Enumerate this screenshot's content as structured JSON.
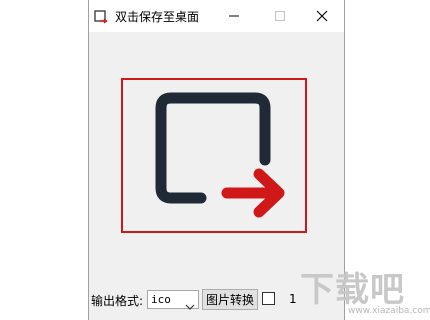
{
  "window": {
    "title": "双击保存至桌面"
  },
  "toolbar": {
    "format_label": "输出格式:",
    "format_value": "ico",
    "convert_label": "图片转换",
    "trailing_text": "1"
  },
  "watermark": {
    "brand": "下载吧",
    "url": "www.xiazaiba.com"
  },
  "colors": {
    "frame_border": "#d01818",
    "arrow": "#d01818",
    "square_stroke": "#1f2a36",
    "window_bg": "#f0f0f0"
  },
  "icons": {
    "app": "export-arrow-icon",
    "preview": "export-arrow-icon",
    "minimize": "minimize-icon",
    "maximize": "maximize-icon",
    "close": "close-icon",
    "dropdown": "chevron-down-icon"
  }
}
